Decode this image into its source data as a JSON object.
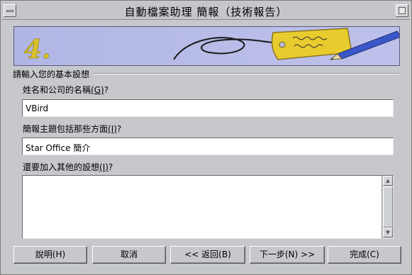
{
  "window": {
    "title": "自動檔案助理 簡報（技術報告）"
  },
  "banner": {
    "step_number": "4.",
    "accent_color": "#e8cc2e"
  },
  "section": {
    "label": "請輸入您的基本設想"
  },
  "fields": {
    "name": {
      "label": "姓名和公司的名稱",
      "hotkey": "(G)",
      "suffix": "?",
      "value": "VBird"
    },
    "topic": {
      "label": "簡報主題包括那些方面",
      "hotkey": "(I)",
      "suffix": "?",
      "value": "Star Office 簡介"
    },
    "other": {
      "label": "還要加入其他的設想",
      "hotkey": "(I)",
      "suffix": "?",
      "value": ""
    }
  },
  "buttons": {
    "help": "說明(H)",
    "cancel": "取消",
    "back": "<< 返回(B)",
    "next": "下一步(N) >>",
    "finish": "完成(C)"
  }
}
